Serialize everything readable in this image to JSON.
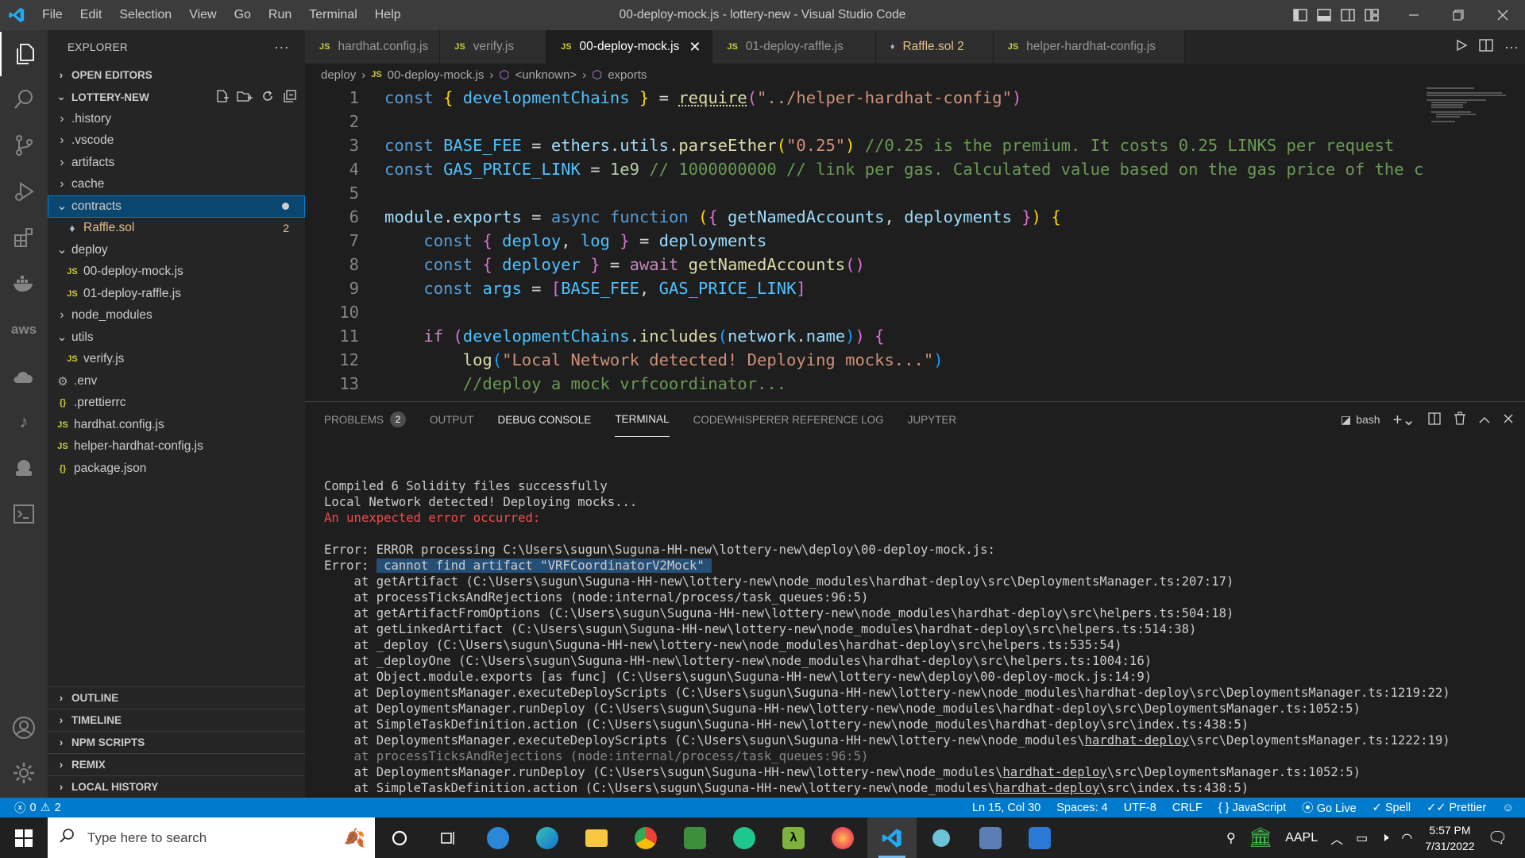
{
  "titlebar": {
    "menu": [
      "File",
      "Edit",
      "Selection",
      "View",
      "Go",
      "Run",
      "Terminal",
      "Help"
    ],
    "window_title": "00-deploy-mock.js - lottery-new - Visual Studio Code"
  },
  "explorer": {
    "header": "EXPLORER",
    "more": "···",
    "open_editors": "OPEN EDITORS",
    "project": "LOTTERY-NEW",
    "tree": [
      {
        "label": ".history",
        "type": "folder",
        "depth": 1,
        "open": false
      },
      {
        "label": ".vscode",
        "type": "folder",
        "depth": 1,
        "open": false
      },
      {
        "label": "artifacts",
        "type": "folder",
        "depth": 1,
        "open": false
      },
      {
        "label": "cache",
        "type": "folder",
        "depth": 1,
        "open": false
      },
      {
        "label": "contracts",
        "type": "folder",
        "depth": 1,
        "open": true,
        "selected": true
      },
      {
        "label": "Raffle.sol",
        "type": "sol",
        "depth": 2,
        "badge": "2"
      },
      {
        "label": "deploy",
        "type": "folder",
        "depth": 1,
        "open": true
      },
      {
        "label": "00-deploy-mock.js",
        "type": "js",
        "depth": 2
      },
      {
        "label": "01-deploy-raffle.js",
        "type": "js",
        "depth": 2
      },
      {
        "label": "node_modules",
        "type": "folder",
        "depth": 1,
        "open": false
      },
      {
        "label": "utils",
        "type": "folder",
        "depth": 1,
        "open": true
      },
      {
        "label": "verify.js",
        "type": "js",
        "depth": 2
      },
      {
        "label": ".env",
        "type": "gear",
        "depth": 1
      },
      {
        "label": ".prettierrc",
        "type": "json",
        "depth": 1
      },
      {
        "label": "hardhat.config.js",
        "type": "js",
        "depth": 1
      },
      {
        "label": "helper-hardhat-config.js",
        "type": "js",
        "depth": 1
      },
      {
        "label": "package.json",
        "type": "json",
        "depth": 1
      }
    ],
    "bottom_sections": [
      "OUTLINE",
      "TIMELINE",
      "NPM SCRIPTS",
      "REMIX",
      "LOCAL HISTORY"
    ]
  },
  "tabs": [
    {
      "label": "hardhat.config.js",
      "icon": "JS"
    },
    {
      "label": "verify.js",
      "icon": "JS"
    },
    {
      "label": "00-deploy-mock.js",
      "icon": "JS",
      "active": true
    },
    {
      "label": "01-deploy-raffle.js",
      "icon": "JS"
    },
    {
      "label": "Raffle.sol 2",
      "icon": "sol"
    },
    {
      "label": "helper-hardhat-config.js",
      "icon": "JS"
    }
  ],
  "breadcrumb": [
    "deploy",
    "00-deploy-mock.js",
    "<unknown>",
    "exports"
  ],
  "code_lines": [
    "1",
    "2",
    "3",
    "4",
    "5",
    "6",
    "7",
    "8",
    "9",
    "10",
    "11",
    "12",
    "13"
  ],
  "panel": {
    "tabs": [
      "PROBLEMS",
      "OUTPUT",
      "DEBUG CONSOLE",
      "TERMINAL",
      "CODEWHISPERER REFERENCE LOG",
      "JUPYTER"
    ],
    "problems_count": "2",
    "shell": "bash"
  },
  "terminal": [
    {
      "t": "Compiled 6 Solidity files successfully"
    },
    {
      "t": "Local Network detected! Deploying mocks..."
    },
    {
      "t": "An unexpected error occurred:",
      "style": "red"
    },
    {
      "t": ""
    },
    {
      "t": "Error: ERROR processing C:\\Users\\sugun\\Suguna-HH-new\\lottery-new\\deploy\\00-deploy-mock.js:"
    },
    {
      "t": "Error: ",
      "hl": " cannot find artifact \"VRFCoordinatorV2Mock\" "
    },
    {
      "t": "    at getArtifact (C:\\Users\\sugun\\Suguna-HH-new\\lottery-new\\node_modules\\hardhat-deploy\\src\\DeploymentsManager.ts:207:17)"
    },
    {
      "t": "    at processTicksAndRejections (node:internal/process/task_queues:96:5)"
    },
    {
      "t": "    at getArtifactFromOptions (C:\\Users\\sugun\\Suguna-HH-new\\lottery-new\\node_modules\\hardhat-deploy\\src\\helpers.ts:504:18)"
    },
    {
      "t": "    at getLinkedArtifact (C:\\Users\\sugun\\Suguna-HH-new\\lottery-new\\node_modules\\hardhat-deploy\\src\\helpers.ts:514:38)"
    },
    {
      "t": "    at _deploy (C:\\Users\\sugun\\Suguna-HH-new\\lottery-new\\node_modules\\hardhat-deploy\\src\\helpers.ts:535:54)"
    },
    {
      "t": "    at _deployOne (C:\\Users\\sugun\\Suguna-HH-new\\lottery-new\\node_modules\\hardhat-deploy\\src\\helpers.ts:1004:16)"
    },
    {
      "t": "    at Object.module.exports [as func] (C:\\Users\\sugun\\Suguna-HH-new\\lottery-new\\deploy\\00-deploy-mock.js:14:9)"
    },
    {
      "t": "    at DeploymentsManager.executeDeployScripts (C:\\Users\\sugun\\Suguna-HH-new\\lottery-new\\node_modules\\hardhat-deploy\\src\\DeploymentsManager.ts:1219:22)"
    },
    {
      "t": "    at DeploymentsManager.runDeploy (C:\\Users\\sugun\\Suguna-HH-new\\lottery-new\\node_modules\\hardhat-deploy\\src\\DeploymentsManager.ts:1052:5)"
    },
    {
      "t": "    at SimpleTaskDefinition.action (C:\\Users\\sugun\\Suguna-HH-new\\lottery-new\\node_modules\\hardhat-deploy\\src\\index.ts:438:5)"
    },
    {
      "t": "    at DeploymentsManager.executeDeployScripts (C:\\Users\\sugun\\Suguna-HH-new\\lottery-new\\node_modules\\",
      "u": "hardhat-deploy",
      "t2": "\\src\\DeploymentsManager.ts:1222:19)"
    },
    {
      "t": "    at processTicksAndRejections (node:internal/process/task_queues:96:5)",
      "style": "dim"
    },
    {
      "t": "    at DeploymentsManager.runDeploy (C:\\Users\\sugun\\Suguna-HH-new\\lottery-new\\node_modules\\",
      "u": "hardhat-deploy",
      "t2": "\\src\\DeploymentsManager.ts:1052:5)"
    },
    {
      "t": "    at SimpleTaskDefinition.action (C:\\Users\\sugun\\Suguna-HH-new\\lottery-new\\node_modules\\",
      "u": "hardhat-deploy",
      "t2": "\\src\\index.ts:438:5)"
    }
  ],
  "statusbar": {
    "errors": "0",
    "warnings": "2",
    "position": "Ln 15, Col 30",
    "spaces": "Spaces: 4",
    "encoding": "UTF-8",
    "eol": "CRLF",
    "language": "{ } JavaScript",
    "golive": "Go Live",
    "spell": "Spell",
    "prettier": "Prettier"
  },
  "taskbar": {
    "search_placeholder": "Type here to search",
    "stock": "AAPL",
    "time": "5:57 PM",
    "date": "7/31/2022"
  }
}
